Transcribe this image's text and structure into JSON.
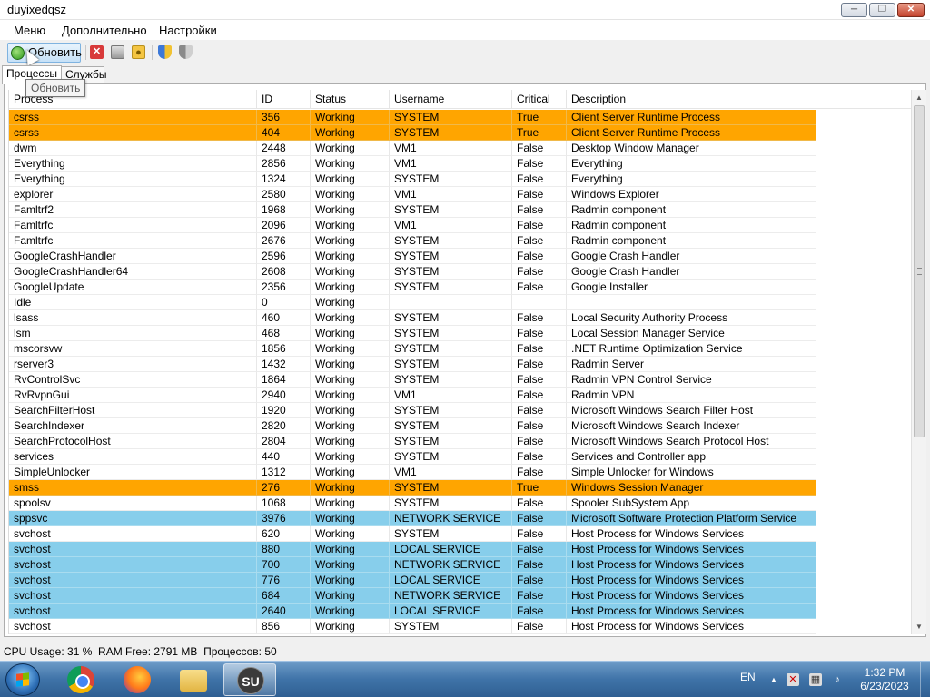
{
  "window": {
    "title": "duyixedqsz"
  },
  "menu": {
    "items": [
      "Меню",
      "Дополнительно",
      "Настройки"
    ]
  },
  "toolbar": {
    "refresh_label": "Обновить",
    "tooltip": "Обновить"
  },
  "tabs": [
    "Процессы",
    "Службы"
  ],
  "colors": {
    "critical_row": "#ffa500",
    "service_row": "#87ceeb"
  },
  "table": {
    "columns": [
      "Process",
      "ID",
      "Status",
      "Username",
      "Critical",
      "Description"
    ],
    "rows": [
      {
        "process": "csrss",
        "id": "356",
        "status": "Working",
        "username": "SYSTEM",
        "critical": "True",
        "description": "Client Server Runtime Process",
        "highlight": "orange"
      },
      {
        "process": "csrss",
        "id": "404",
        "status": "Working",
        "username": "SYSTEM",
        "critical": "True",
        "description": "Client Server Runtime Process",
        "highlight": "orange"
      },
      {
        "process": "dwm",
        "id": "2448",
        "status": "Working",
        "username": "VM1",
        "critical": "False",
        "description": "Desktop Window Manager",
        "highlight": ""
      },
      {
        "process": "Everything",
        "id": "2856",
        "status": "Working",
        "username": "VM1",
        "critical": "False",
        "description": "Everything",
        "highlight": ""
      },
      {
        "process": "Everything",
        "id": "1324",
        "status": "Working",
        "username": "SYSTEM",
        "critical": "False",
        "description": "Everything",
        "highlight": ""
      },
      {
        "process": "explorer",
        "id": "2580",
        "status": "Working",
        "username": "VM1",
        "critical": "False",
        "description": "Windows Explorer",
        "highlight": ""
      },
      {
        "process": "Famltrf2",
        "id": "1968",
        "status": "Working",
        "username": "SYSTEM",
        "critical": "False",
        "description": "Radmin component",
        "highlight": ""
      },
      {
        "process": "Famltrfc",
        "id": "2096",
        "status": "Working",
        "username": "VM1",
        "critical": "False",
        "description": "Radmin component",
        "highlight": ""
      },
      {
        "process": "Famltrfc",
        "id": "2676",
        "status": "Working",
        "username": "SYSTEM",
        "critical": "False",
        "description": "Radmin component",
        "highlight": ""
      },
      {
        "process": "GoogleCrashHandler",
        "id": "2596",
        "status": "Working",
        "username": "SYSTEM",
        "critical": "False",
        "description": "Google Crash Handler",
        "highlight": ""
      },
      {
        "process": "GoogleCrashHandler64",
        "id": "2608",
        "status": "Working",
        "username": "SYSTEM",
        "critical": "False",
        "description": "Google Crash Handler",
        "highlight": ""
      },
      {
        "process": "GoogleUpdate",
        "id": "2356",
        "status": "Working",
        "username": "SYSTEM",
        "critical": "False",
        "description": "Google Installer",
        "highlight": ""
      },
      {
        "process": "Idle",
        "id": "0",
        "status": "Working",
        "username": "",
        "critical": "",
        "description": "",
        "highlight": ""
      },
      {
        "process": "lsass",
        "id": "460",
        "status": "Working",
        "username": "SYSTEM",
        "critical": "False",
        "description": "Local Security Authority Process",
        "highlight": ""
      },
      {
        "process": "lsm",
        "id": "468",
        "status": "Working",
        "username": "SYSTEM",
        "critical": "False",
        "description": "Local Session Manager Service",
        "highlight": ""
      },
      {
        "process": "mscorsvw",
        "id": "1856",
        "status": "Working",
        "username": "SYSTEM",
        "critical": "False",
        "description": ".NET Runtime Optimization Service",
        "highlight": ""
      },
      {
        "process": "rserver3",
        "id": "1432",
        "status": "Working",
        "username": "SYSTEM",
        "critical": "False",
        "description": "Radmin Server",
        "highlight": ""
      },
      {
        "process": "RvControlSvc",
        "id": "1864",
        "status": "Working",
        "username": "SYSTEM",
        "critical": "False",
        "description": "Radmin VPN Control Service",
        "highlight": ""
      },
      {
        "process": "RvRvpnGui",
        "id": "2940",
        "status": "Working",
        "username": "VM1",
        "critical": "False",
        "description": "Radmin VPN",
        "highlight": ""
      },
      {
        "process": "SearchFilterHost",
        "id": "1920",
        "status": "Working",
        "username": "SYSTEM",
        "critical": "False",
        "description": "Microsoft Windows Search Filter Host",
        "highlight": ""
      },
      {
        "process": "SearchIndexer",
        "id": "2820",
        "status": "Working",
        "username": "SYSTEM",
        "critical": "False",
        "description": "Microsoft Windows Search Indexer",
        "highlight": ""
      },
      {
        "process": "SearchProtocolHost",
        "id": "2804",
        "status": "Working",
        "username": "SYSTEM",
        "critical": "False",
        "description": "Microsoft Windows Search Protocol Host",
        "highlight": ""
      },
      {
        "process": "services",
        "id": "440",
        "status": "Working",
        "username": "SYSTEM",
        "critical": "False",
        "description": "Services and Controller app",
        "highlight": ""
      },
      {
        "process": "SimpleUnlocker",
        "id": "1312",
        "status": "Working",
        "username": "VM1",
        "critical": "False",
        "description": "Simple Unlocker for Windows",
        "highlight": ""
      },
      {
        "process": "smss",
        "id": "276",
        "status": "Working",
        "username": "SYSTEM",
        "critical": "True",
        "description": "Windows Session Manager",
        "highlight": "orange"
      },
      {
        "process": "spoolsv",
        "id": "1068",
        "status": "Working",
        "username": "SYSTEM",
        "critical": "False",
        "description": "Spooler SubSystem App",
        "highlight": ""
      },
      {
        "process": "sppsvc",
        "id": "3976",
        "status": "Working",
        "username": "NETWORK SERVICE",
        "critical": "False",
        "description": "Microsoft Software Protection Platform Service",
        "highlight": "blue"
      },
      {
        "process": "svchost",
        "id": "620",
        "status": "Working",
        "username": "SYSTEM",
        "critical": "False",
        "description": "Host Process for Windows Services",
        "highlight": ""
      },
      {
        "process": "svchost",
        "id": "880",
        "status": "Working",
        "username": "LOCAL SERVICE",
        "critical": "False",
        "description": "Host Process for Windows Services",
        "highlight": "blue"
      },
      {
        "process": "svchost",
        "id": "700",
        "status": "Working",
        "username": "NETWORK SERVICE",
        "critical": "False",
        "description": "Host Process for Windows Services",
        "highlight": "blue"
      },
      {
        "process": "svchost",
        "id": "776",
        "status": "Working",
        "username": "LOCAL SERVICE",
        "critical": "False",
        "description": "Host Process for Windows Services",
        "highlight": "blue"
      },
      {
        "process": "svchost",
        "id": "684",
        "status": "Working",
        "username": "NETWORK SERVICE",
        "critical": "False",
        "description": "Host Process for Windows Services",
        "highlight": "blue"
      },
      {
        "process": "svchost",
        "id": "2640",
        "status": "Working",
        "username": "LOCAL SERVICE",
        "critical": "False",
        "description": "Host Process for Windows Services",
        "highlight": "blue"
      },
      {
        "process": "svchost",
        "id": "856",
        "status": "Working",
        "username": "SYSTEM",
        "critical": "False",
        "description": "Host Process for Windows Services",
        "highlight": ""
      }
    ]
  },
  "status": {
    "text": "CPU Usage: 31 %  RAM Free: 2791 MB  Процессов: 50"
  },
  "taskbar": {
    "apps": [
      "chrome-icon",
      "firefox-icon",
      "folder-icon",
      "su-icon"
    ],
    "su_label": "SU",
    "language": "EN",
    "time": "1:32 PM",
    "date": "6/23/2023"
  }
}
